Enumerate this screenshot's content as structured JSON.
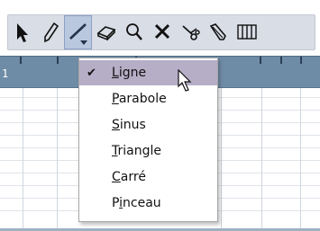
{
  "toolbar": {
    "tools": [
      {
        "name": "pointer-icon"
      },
      {
        "name": "pencil-icon"
      },
      {
        "name": "line-icon",
        "active": true
      },
      {
        "name": "eraser-icon"
      },
      {
        "name": "zoom-icon"
      },
      {
        "name": "mute-icon"
      },
      {
        "name": "scissors-icon"
      },
      {
        "name": "paint-icon"
      },
      {
        "name": "quantize-grid-icon"
      }
    ]
  },
  "ruler": {
    "label": "1"
  },
  "menu": {
    "items": [
      {
        "first": "L",
        "rest": "igne",
        "checked": true
      },
      {
        "first": "P",
        "rest": "arabole"
      },
      {
        "first": "S",
        "rest": "inus"
      },
      {
        "first": "T",
        "rest": "riangle"
      },
      {
        "first": "C",
        "rest": "arré"
      },
      {
        "pre": "P",
        "first": "i",
        "rest": "nceau"
      }
    ],
    "checkmark": "✔"
  },
  "colors": {
    "selection": "#b6adc6",
    "ruler": "#6f8ca6",
    "toolbar": "#d9dde6"
  }
}
